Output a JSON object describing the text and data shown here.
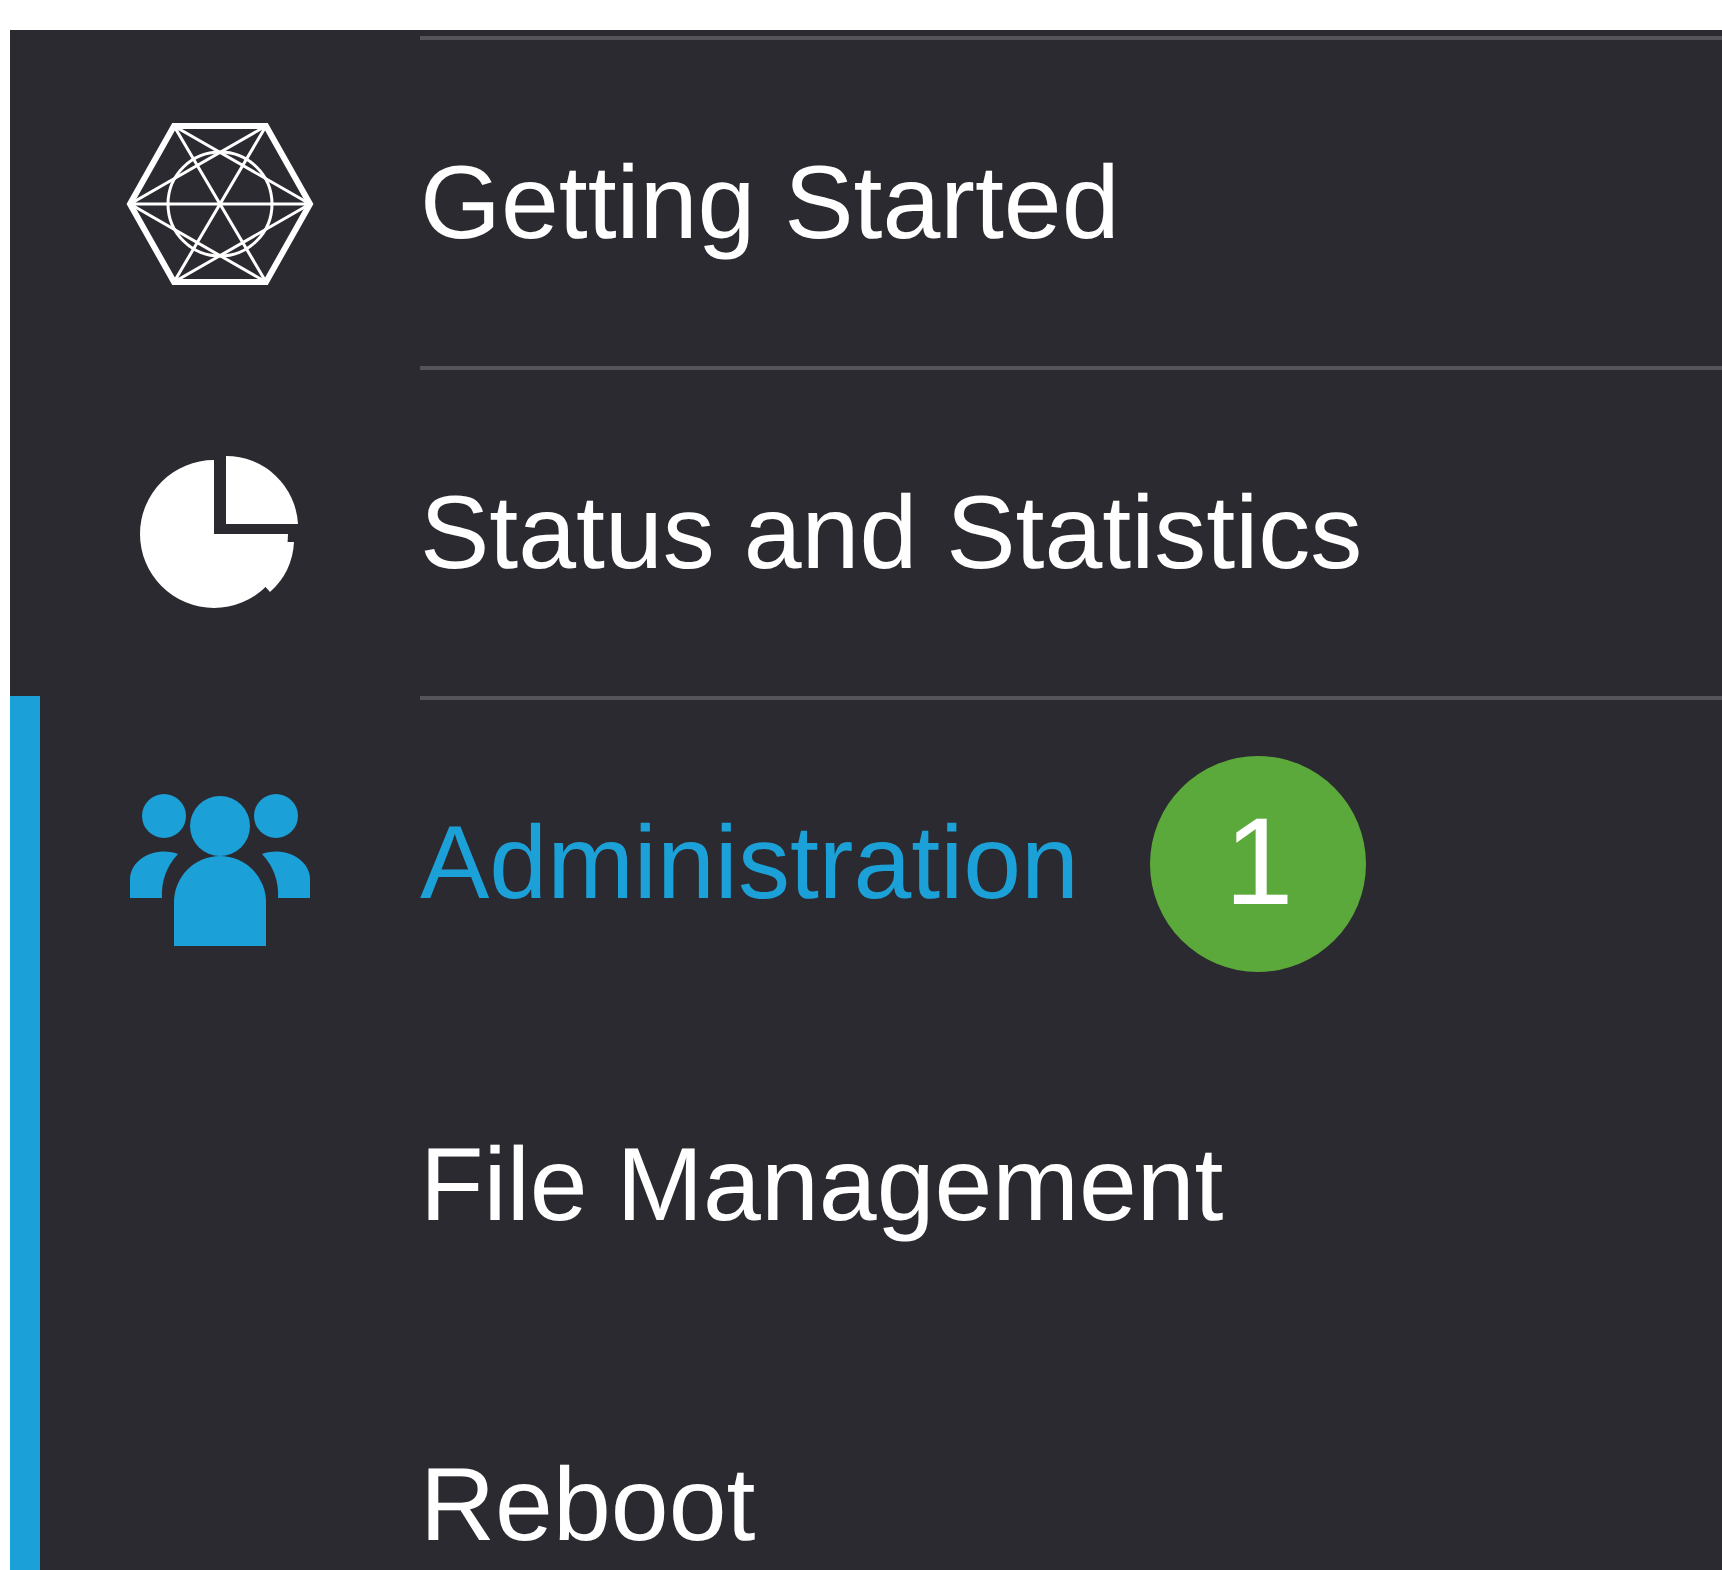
{
  "sidebar": {
    "items": [
      {
        "label": "Getting Started",
        "selected": false,
        "expanded": false
      },
      {
        "label": "Status and Statistics",
        "selected": false,
        "expanded": false
      },
      {
        "label": "Administration",
        "selected": true,
        "expanded": true,
        "badge": "1",
        "children": [
          {
            "label": "File Management",
            "selected": false
          },
          {
            "label": "Reboot",
            "selected": false
          }
        ]
      }
    ]
  }
}
